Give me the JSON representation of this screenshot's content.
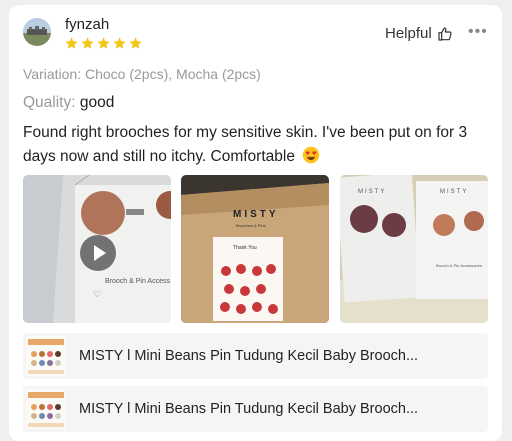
{
  "review": {
    "username": "fynzah",
    "rating": 5,
    "helpful_label": "Helpful",
    "more_label": "•••",
    "variation": "Variation: Choco (2pcs), Mocha (2pcs)",
    "quality_label": "Quality:",
    "quality_value": "good",
    "text": "Found right brooches for my sensitive skin. I've been put on for 3 days now and still no itchy. Comfortable",
    "emoji": "heart-eyes-emoji",
    "media": [
      {
        "type": "video",
        "card_text": "Brooch & Pin Access"
      },
      {
        "type": "image",
        "brand": "MISTY",
        "tagline": "Brooches & Pins",
        "sticker": "Thank You"
      },
      {
        "type": "image",
        "brand": "MISTY",
        "card_text": "Brooch & Pin Accessories"
      }
    ],
    "products": [
      {
        "name": "MISTY l Mini Beans Pin Tudung Kecil Baby Brooch..."
      },
      {
        "name": "MISTY l Mini Beans Pin Tudung Kecil Baby Brooch..."
      }
    ]
  },
  "colors": {
    "star": "#f5c518",
    "muted_text": "#9a9a9a",
    "product_bg": "#f5f5f5"
  }
}
